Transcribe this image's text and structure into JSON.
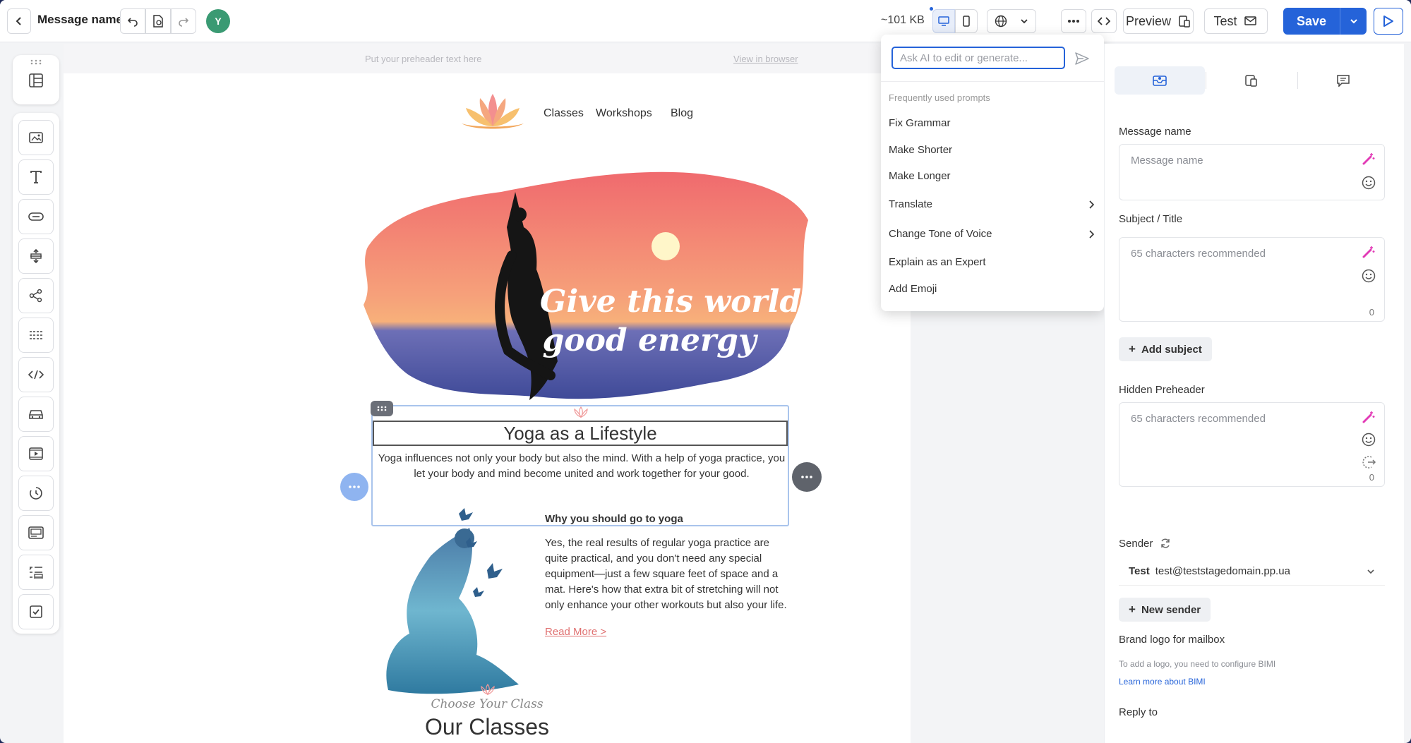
{
  "topbar": {
    "back_icon": "chevron-left-icon",
    "message_name": "Message name",
    "undo_icon": "undo-icon",
    "history_icon": "document-history-icon",
    "redo_icon": "redo-icon",
    "avatar_initial": "Y",
    "size": "~101 KB",
    "desktop_icon": "desktop-icon",
    "mobile_icon": "mobile-icon",
    "language_icon": "globe-icon",
    "more_icon": "more-horizontal-icon",
    "code_icon": "code-icon",
    "preview_label": "Preview",
    "test_label": "Test",
    "save_label": "Save",
    "accent": "#2563d9"
  },
  "rail": {
    "top_item": "layout-blocks-icon",
    "items": [
      "image-icon",
      "text-icon",
      "button-icon",
      "spacer-icon",
      "social-icon",
      "divider-icon",
      "html-code-icon",
      "product-card-icon",
      "video-icon",
      "timer-icon",
      "banner-icon",
      "menu-list-icon",
      "checkbox-icon"
    ]
  },
  "canvas": {
    "preheader": "Put your preheader text here",
    "view_in_browser": "View in browser",
    "nav": [
      "Classes",
      "Workshops",
      "Blog"
    ],
    "hero_line1": "Give this world",
    "hero_line2": "good energy",
    "section_title": "Yoga as a Lifestyle",
    "section_text": "Yoga influences not only your body but also the mind. With a help of yoga practice, you let your body and mind become united and work together for your good.",
    "why_title": "Why you should go to yoga",
    "why_body": "Yes, the real results of regular yoga practice are quite practical, and you don't need any special equipment—just a few square feet of space and a mat. Here's how that extra bit of stretching will not only enhance your other workouts but also your life.",
    "read_more": "Read More >",
    "choose_class": "Choose Your Class",
    "our_classes": "Our Classes"
  },
  "ai": {
    "placeholder": "Ask AI to edit or generate...",
    "heading": "Frequently used prompts",
    "items": [
      {
        "label": "Fix Grammar",
        "submenu": false
      },
      {
        "label": "Make Shorter",
        "submenu": false
      },
      {
        "label": "Make Longer",
        "submenu": false
      },
      {
        "label": "Translate",
        "submenu": true
      },
      {
        "label": "Change Tone of Voice",
        "submenu": true
      },
      {
        "label": "Explain as an Expert",
        "submenu": false
      },
      {
        "label": "Add Emoji",
        "submenu": false
      }
    ]
  },
  "panel": {
    "tabs": [
      "mailbox-settings-icon",
      "mobile-preview-icon",
      "comments-icon"
    ],
    "message_name_label": "Message name",
    "message_name_placeholder": "Message name",
    "subject_label": "Subject / Title",
    "subject_placeholder": "65 characters recommended",
    "subject_count": "0",
    "add_subject": "Add subject",
    "preheader_label": "Hidden Preheader",
    "preheader_placeholder": "65 characters recommended",
    "preheader_count": "0",
    "sender_label": "Sender",
    "sender_name": "Test",
    "sender_email": "test@teststagedomain.pp.ua",
    "new_sender": "New sender",
    "brand_logo_label": "Brand logo for mailbox",
    "bimi_note": "To add a logo, you need to configure BIMI",
    "bimi_link": "Learn more about BIMI",
    "reply_to_label": "Reply to"
  }
}
